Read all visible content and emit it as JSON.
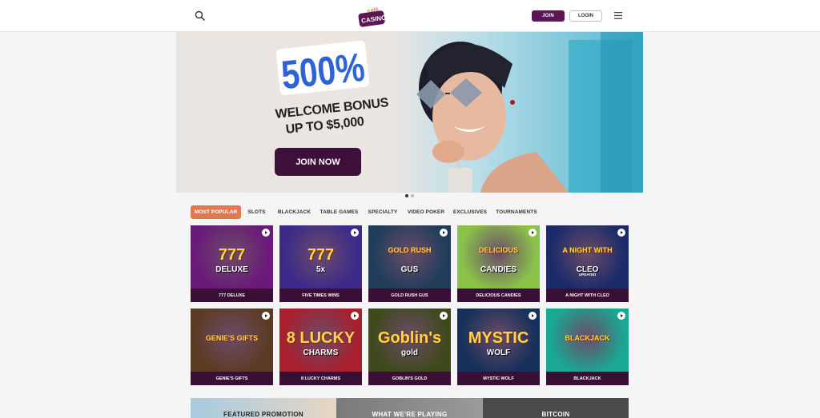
{
  "header": {
    "logo_top": "café",
    "logo_bottom": "CASINO",
    "join_label": "JOIN",
    "login_label": "LOGIN"
  },
  "hero": {
    "bonus_percent": "500%",
    "line1": "WELCOME BONUS",
    "line2": "UP TO $5,000",
    "cta": "JOIN NOW",
    "slides": 2,
    "active_slide": 1
  },
  "tabs": [
    {
      "label": "MOST POPULAR",
      "active": true
    },
    {
      "label": "SLOTS",
      "active": false
    },
    {
      "label": "BLACKJACK",
      "active": false
    },
    {
      "label": "TABLE GAMES",
      "active": false
    },
    {
      "label": "SPECIALTY",
      "active": false
    },
    {
      "label": "VIDEO POKER",
      "active": false
    },
    {
      "label": "EXCLUSIVES",
      "active": false
    },
    {
      "label": "TOURNAMENTS",
      "active": false
    }
  ],
  "games": [
    {
      "label": "777 DELUXE",
      "art_text": "777",
      "art_sub": "DELUXE",
      "bg": "#6a1a78"
    },
    {
      "label": "FIVE TIMES WINS",
      "art_text": "777",
      "art_sub": "5x",
      "bg": "#3b2a8a"
    },
    {
      "label": "GOLD RUSH GUS",
      "art_text": "GOLD RUSH",
      "art_sub": "GUS",
      "bg": "#1f3d5a"
    },
    {
      "label": "DELICIOUS CANDIES",
      "art_text": "DELICIOUS",
      "art_sub": "CANDIES",
      "bg": "#8bc34a"
    },
    {
      "label": "A NIGHT WITH CLEO",
      "art_text": "A NIGHT WITH",
      "art_sub": "CLEO",
      "badge": "UPDATED",
      "bg": "#1b2a6b"
    },
    {
      "label": "GENIE'S GIFTS",
      "art_text": "GENIE'S GIFTS",
      "art_sub": "",
      "bg": "#5c3b24"
    },
    {
      "label": "8 LUCKY CHARMS",
      "art_text": "8 LUCKY",
      "art_sub": "CHARMS",
      "bg": "#a81f2e"
    },
    {
      "label": "GOBLIN'S GOLD",
      "art_text": "Goblin's",
      "art_sub": "gold",
      "bg": "#3e4a1c"
    },
    {
      "label": "MYSTIC WOLF",
      "art_text": "MYSTIC",
      "art_sub": "WOLF",
      "bg": "#16305a"
    },
    {
      "label": "BLACKJACK",
      "art_text": "BLACKJACK",
      "art_sub": "",
      "bg": "#1aa893"
    }
  ],
  "promos": [
    {
      "label": "FEATURED PROMOTION"
    },
    {
      "label": "WHAT WE'RE PLAYING"
    },
    {
      "label": "BITCOIN"
    }
  ],
  "colors": {
    "brand_purple": "#5b1655",
    "tile_label_bg": "#3a0f36",
    "active_tab": "#e0794f",
    "hero_blue": "#2e63d6"
  }
}
